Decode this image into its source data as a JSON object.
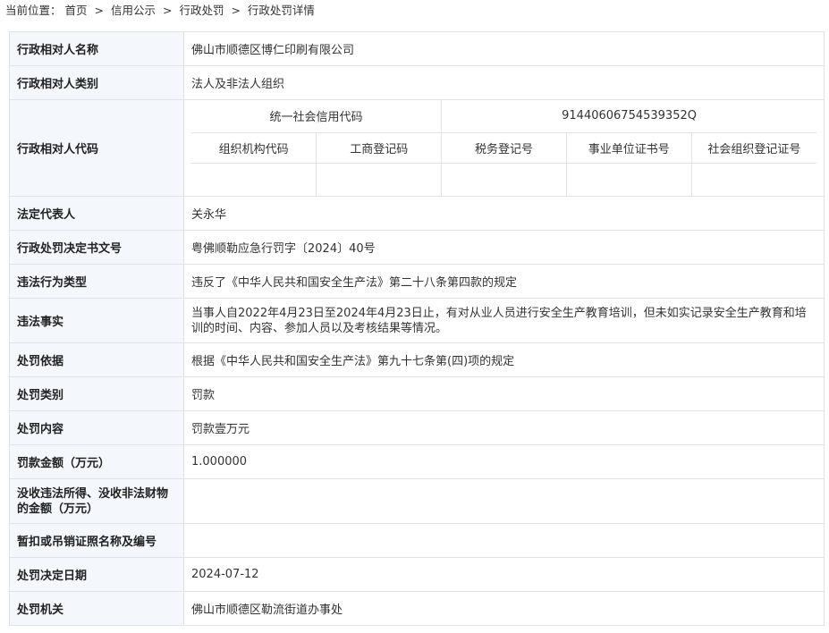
{
  "breadcrumb": {
    "prefix": "当前位置：",
    "items": [
      "首页",
      "信用公示",
      "行政处罚",
      "行政处罚详情"
    ],
    "separator": ">"
  },
  "record": {
    "party_name": {
      "label": "行政相对人名称",
      "value": "佛山市顺德区博仁印刷有限公司"
    },
    "party_type": {
      "label": "行政相对人类别",
      "value": "法人及非法人组织"
    },
    "party_code": {
      "label": "行政相对人代码",
      "credit_code_header": "统一社会信用代码",
      "credit_code_value": "91440606754539352Q",
      "sub_headers": [
        "组织机构代码",
        "工商登记码",
        "税务登记号",
        "事业单位证书号",
        "社会组织登记证号"
      ],
      "sub_values": [
        "",
        "",
        "",
        "",
        ""
      ]
    },
    "legal_rep": {
      "label": "法定代表人",
      "value": "关永华"
    },
    "decision_no": {
      "label": "行政处罚决定书文号",
      "value": "粤佛顺勒应急行罚字〔2024〕40号"
    },
    "violation_type": {
      "label": "违法行为类型",
      "value": "违反了《中华人民共和国安全生产法》第二十八条第四款的规定"
    },
    "violation_facts": {
      "label": "违法事实",
      "value": "当事人自2022年4月23日至2024年4月23日止，有对从业人员进行安全生产教育培训，但未如实记录安全生产教育和培训的时间、内容、参加人员以及考核结果等情况。"
    },
    "penalty_basis": {
      "label": "处罚依据",
      "value": "根据《中华人民共和国安全生产法》第九十七条第(四)项的规定"
    },
    "penalty_category": {
      "label": "处罚类别",
      "value": "罚款"
    },
    "penalty_content": {
      "label": "处罚内容",
      "value": "罚款壹万元"
    },
    "fine_amount": {
      "label": "罚款金额（万元）",
      "value": "1.000000"
    },
    "confiscation_amount": {
      "label": "没收违法所得、没收非法财物的金额（万元）",
      "value": ""
    },
    "license_revocation": {
      "label": "暂扣或吊销证照名称及编号",
      "value": ""
    },
    "decision_date": {
      "label": "处罚决定日期",
      "value": "2024-07-12"
    },
    "authority": {
      "label": "处罚机关",
      "value": "佛山市顺德区勒流街道办事处"
    }
  }
}
